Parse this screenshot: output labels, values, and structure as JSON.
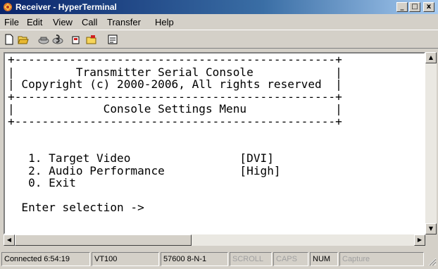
{
  "window": {
    "title": "Receiver - HyperTerminal",
    "controls": {
      "minimize": "_",
      "maximize": "□",
      "close": "x"
    }
  },
  "menu": [
    "File",
    "Edit",
    "View",
    "Call",
    "Transfer",
    "Help"
  ],
  "toolbar": [
    "new-connection-icon",
    "open-icon",
    "connect-icon",
    "disconnect-icon",
    "send-icon",
    "receive-icon",
    "properties-icon"
  ],
  "terminal": {
    "lines": [
      "+-----------------------------------------------+",
      "|         Transmitter Serial Console            |",
      "| Copyright (c) 2000-2006, All rights reserved  |",
      "+-----------------------------------------------+",
      "|             Console Settings Menu             |",
      "+-----------------------------------------------+",
      "",
      "",
      "   1. Target Video                [DVI]",
      "   2. Audio Performance           [High]",
      "   0. Exit",
      "",
      "  Enter selection ->"
    ]
  },
  "status": {
    "connected": "Connected 6:54:19",
    "emulation": "VT100",
    "port_settings": "57600 8-N-1",
    "scroll": "SCROLL",
    "caps": "CAPS",
    "num": "NUM",
    "capture": "Capture"
  }
}
